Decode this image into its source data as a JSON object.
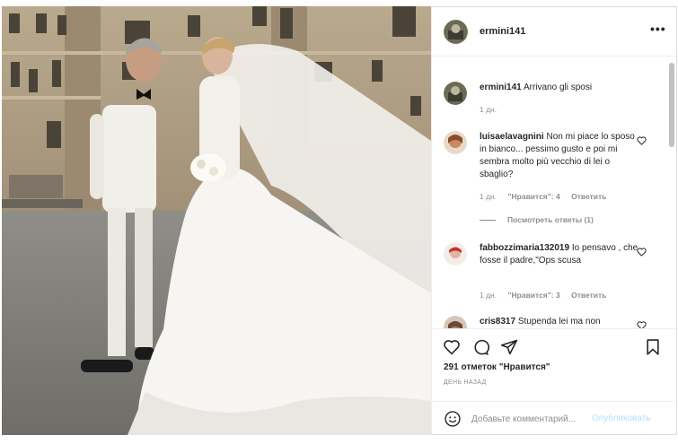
{
  "post": {
    "username": "ermini141",
    "more_label": "•••",
    "likes_text": "291 отметок \"Нравится\"",
    "date_text": "ДЕНЬ НАЗАД"
  },
  "comments": [
    {
      "username": "ermini141",
      "text": "Arrivano gli sposi",
      "age": "1 дн."
    },
    {
      "username": "luisaelavagnini",
      "text": "Non mi piace lo sposo in bianco... pessimo gusto e poi mi sembra molto più vecchio di lei o sbaglio?",
      "age": "1 дн.",
      "likes": "\"Нравится\": 4",
      "reply": "Ответить",
      "replies": "Посмотреть ответы (1)"
    },
    {
      "username": "fabbozzimaria132019",
      "text": "Io pensavo , che fosse il padre,\"Ops scusa",
      "age": "1 дн.",
      "likes": "\"Нравится\": 3",
      "reply": "Ответить"
    },
    {
      "username": "cris8317",
      "text": "Stupenda lei ma non"
    }
  ],
  "add_comment": {
    "placeholder": "Добавьте комментарий...",
    "post_label": "Опубликовать"
  },
  "icons": {
    "like": "heart-icon",
    "comment": "comment-icon",
    "share": "share-icon",
    "save": "bookmark-icon",
    "emoji": "emoji-icon",
    "more": "more-icon"
  },
  "colors": {
    "text": "#262626",
    "muted": "#8e8e8e",
    "post_button": "#b2dffc",
    "border": "#dbdbdb"
  }
}
